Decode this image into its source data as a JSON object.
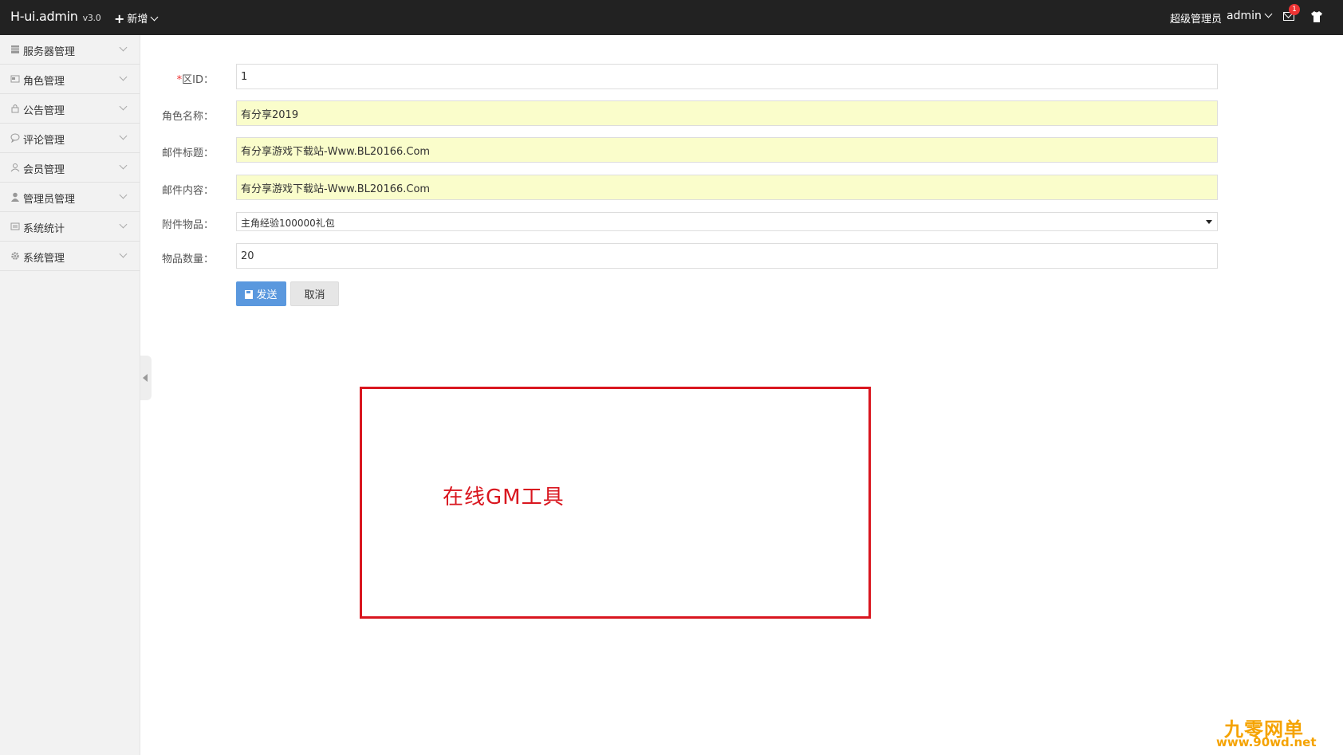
{
  "header": {
    "brand": "H-ui.admin",
    "version": "v3.0",
    "add_menu_label": "新增",
    "user_role": "超级管理员",
    "username": "admin",
    "message_count": "1"
  },
  "sidebar": {
    "items": [
      {
        "label": "服务器管理",
        "icon": "server-icon"
      },
      {
        "label": "角色管理",
        "icon": "role-icon"
      },
      {
        "label": "公告管理",
        "icon": "announcement-icon"
      },
      {
        "label": "评论管理",
        "icon": "comment-icon"
      },
      {
        "label": "会员管理",
        "icon": "member-icon"
      },
      {
        "label": "管理员管理",
        "icon": "admin-icon"
      },
      {
        "label": "系统统计",
        "icon": "stats-icon"
      },
      {
        "label": "系统管理",
        "icon": "gear-icon"
      }
    ]
  },
  "form": {
    "zone_id": {
      "label": "区ID：",
      "required_mark": "*",
      "value": "1"
    },
    "role_name": {
      "label": "角色名称：",
      "value": "有分享2019"
    },
    "mail_title": {
      "label": "邮件标题：",
      "value": "有分享游戏下载站-Www.BL20166.Com"
    },
    "mail_content": {
      "label": "邮件内容：",
      "value": "有分享游戏下载站-Www.BL20166.Com"
    },
    "attachment": {
      "label": "附件物品：",
      "selected": "主角经验100000礼包"
    },
    "quantity": {
      "label": "物品数量：",
      "value": "20"
    },
    "send_label": "发送",
    "cancel_label": "取消"
  },
  "annotation": {
    "text": "在线GM工具",
    "color": "#d9161f"
  },
  "watermark": {
    "title": "九零网单",
    "url": "www.90wd.net",
    "color": "#f5a300"
  },
  "colors": {
    "topbar": "#222222",
    "primary_button": "#5a98de",
    "autofill": "#fafdcb"
  }
}
